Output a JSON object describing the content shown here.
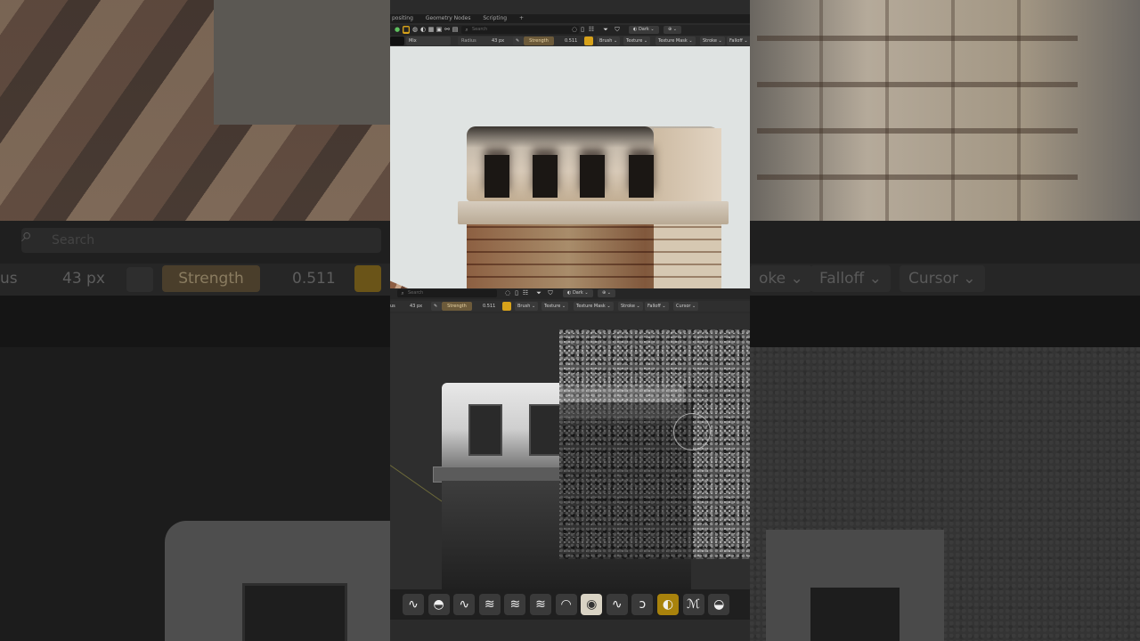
{
  "background": {
    "search_placeholder": "Search",
    "radius_label": "us",
    "radius_value": "43 px",
    "strength_label": "Strength",
    "strength_value": "0.511",
    "dropdowns": [
      "oke",
      "Falloff",
      "Cursor"
    ]
  },
  "app": {
    "menu_tabs": [
      "positing",
      "Geometry Nodes",
      "Scripting",
      "+"
    ],
    "header": {
      "search_placeholder": "Search",
      "theme_label": "Dark"
    },
    "toolbar": {
      "mode_value": "Mix",
      "radius_label": "Radius",
      "radius_value": "43 px",
      "strength_label": "Strength",
      "strength_value": "0.511",
      "dropdowns": [
        "Brush",
        "Texture",
        "Texture Mask",
        "Stroke",
        "Falloff"
      ]
    },
    "toolbar2": {
      "radius_label": "us",
      "radius_value": "43 px",
      "strength_label": "Strength",
      "strength_value": "0.511",
      "dropdowns": [
        "Brush",
        "Texture",
        "Texture Mask",
        "Stroke",
        "Falloff",
        "Cursor"
      ],
      "search_placeholder": "Search",
      "theme_label": "Dark"
    },
    "brushes": [
      {
        "name": "draw-brush-icon",
        "glyph": "∿"
      },
      {
        "name": "smooth-brush-icon",
        "glyph": "◓"
      },
      {
        "name": "soften-brush-icon",
        "glyph": "∿"
      },
      {
        "name": "clone-brush-icon",
        "glyph": "≋"
      },
      {
        "name": "smear-brush-icon",
        "glyph": "≋"
      },
      {
        "name": "fill-brush-icon",
        "glyph": "≋"
      },
      {
        "name": "mask-brush-icon",
        "glyph": "◠"
      },
      {
        "name": "texture-brush-icon",
        "glyph": "◉"
      },
      {
        "name": "blur-brush-icon",
        "glyph": "∿"
      },
      {
        "name": "line-brush-icon",
        "glyph": "ↄ"
      },
      {
        "name": "airbrush-icon",
        "glyph": "◐"
      },
      {
        "name": "scratch-brush-icon",
        "glyph": "ℳ"
      },
      {
        "name": "wave-brush-icon",
        "glyph": "◒"
      }
    ],
    "active_brush_index": 10,
    "selected_brush_index": 7,
    "accent_color": "#d7a21a"
  }
}
